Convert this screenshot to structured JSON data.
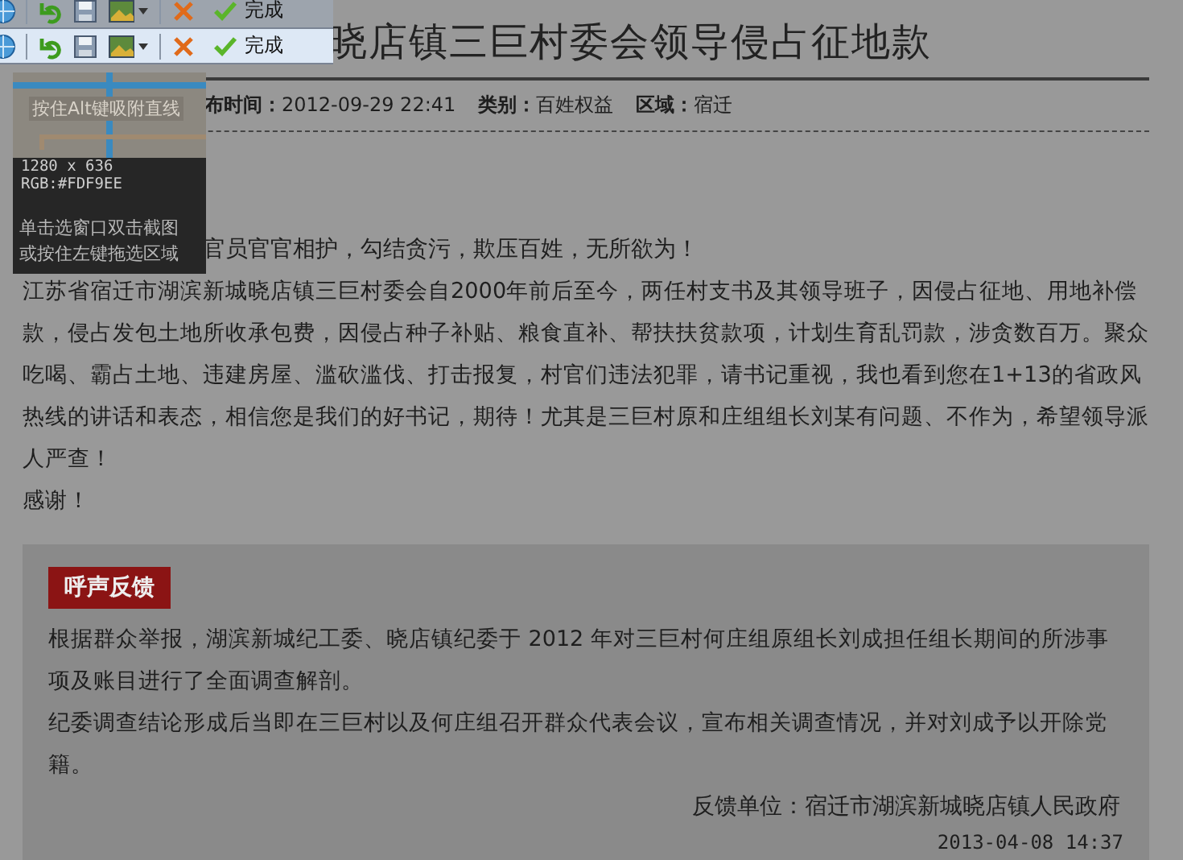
{
  "article": {
    "title": "晓店镇三巨村委会领导侵占征地款",
    "meta": [
      "**布时间：**2012-09-29 22:41",
      "**类别：**百姓权益",
      "**区域：**宿迁"
    ],
    "first_line": "官员官官相护，勾结贪污，欺压百姓，无所欲为！",
    "paragraphs": [
      "江苏省宿迁市湖滨新城晓店镇三巨村委会自2000年前后至今，两任村支书及其领导班子，因侵占征地、用地补偿款，侵占发包土地所收承包费，因侵占种子补贴、粮食直补、帮扶扶贫款项，计划生育乱罚款，涉贪数百万。聚众吃喝、霸占土地、违建房屋、滥砍滥伐、打击报复，村官们违法犯罪，请书记重视，我也看到您在1+13的省政风热线的讲话和表态，相信您是我们的好书记，期待！尤其是三巨村原和庄组组长刘某有问题、不作为，希望领导派人严查！",
      "感谢！"
    ]
  },
  "feedback": {
    "badge": "呼声反馈",
    "paragraphs": [
      "根据群众举报，湖滨新城纪工委、晓店镇纪委于 2012 年对三巨村何庄组原组长刘成担任组长期间的所涉事项及账目进行了全面调查解剖。",
      "纪委调查结论形成后当即在三巨村以及何庄组召开群众代表会议，宣布相关调查情况，并对刘成予以开除党籍。"
    ],
    "unit": "反馈单位：宿迁市湖滨新城晓店镇人民政府",
    "date": "2013-04-08 14:37"
  },
  "toolbars": [
    {
      "active": false,
      "done_label": "完成"
    },
    {
      "active": true,
      "done_label": "完成"
    }
  ],
  "magnifier": {
    "hint": "按住Alt键吸附直线",
    "size": "1280 x 636",
    "pixel_value": "RGB:#FDF9EE",
    "instructions": [
      "单击选窗口双击截图",
      "或按住左键拖选区域"
    ]
  }
}
